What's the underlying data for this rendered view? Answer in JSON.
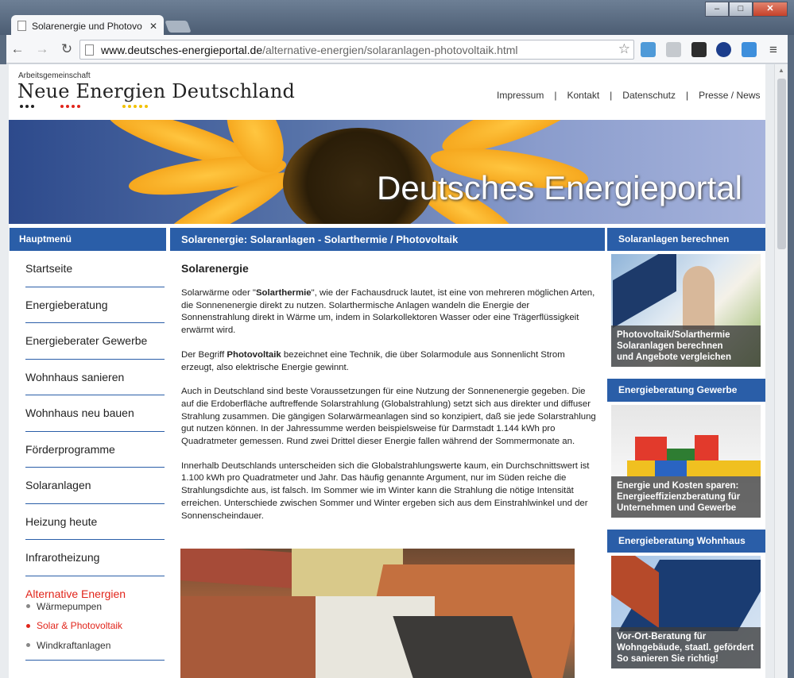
{
  "browser": {
    "tab_title": "Solarenergie und Photovo",
    "url_domain": "www.deutsches-energieportal.de",
    "url_path": "/alternative-energien/solaranlagen-photovoltaik.html",
    "window_min": "–",
    "window_max": "□",
    "window_close": "✕"
  },
  "site": {
    "org_line": "Arbeitsgemeinschaft",
    "logo": "Neue Energien Deutschland",
    "nav": [
      "Impressum",
      "Kontakt",
      "Datenschutz",
      "Presse / News"
    ],
    "banner_title": "Deutsches Energieportal"
  },
  "sidebar": {
    "header": "Hauptmenü",
    "items": [
      "Startseite",
      "Energieberatung",
      "Energieberater Gewerbe",
      "Wohnhaus sanieren",
      "Wohnhaus neu bauen",
      "Förderprogramme",
      "Solaranlagen",
      "Heizung heute",
      "Infrarotheizung"
    ],
    "active_section": "Alternative Energien",
    "subitems": [
      "Wärmepumpen",
      "Solar & Photovoltaik",
      "Windkraftanlagen"
    ]
  },
  "content": {
    "header": "Solarenergie: Solaranlagen - Solarthermie / Photovoltaik",
    "title": "Solarenergie",
    "p1_a": "Solarwärme oder \"",
    "p1_b": "Solarthermie",
    "p1_c": "\", wie der Fachausdruck lautet, ist eine von mehreren möglichen Arten, die Sonnenenergie direkt zu nutzen. Solarthermische Anlagen wandeln die Energie der Sonnenstrahlung direkt in Wärme um, indem in Solarkollektoren Wasser oder eine Trägerflüssigkeit erwärmt wird.",
    "p2_a": "Der Begriff ",
    "p2_b": "Photovoltaik",
    "p2_c": " bezeichnet eine Technik, die über Solarmodule aus Sonnenlicht Strom erzeugt, also elektrische Energie gewinnt.",
    "p3": "Auch in Deutschland sind beste Voraussetzungen für eine Nutzung der Sonnenenergie gegeben. Die auf die Erdoberfläche auftreffende Solarstrahlung (Globalstrahlung) setzt sich aus direkter und diffuser Strahlung zusammen. Die gängigen Solarwärmeanlagen sind so konzipiert, daß sie jede Solarstrahlung gut nutzen können. In der Jahressumme werden beispielsweise für Darmstadt 1.144 kWh pro Quadratmeter gemessen. Rund zwei Drittel dieser Energie fallen während der Sommermonate an.",
    "p4": "Innerhalb Deutschlands unterscheiden sich die Globalstrahlungswerte kaum, ein Durchschnittswert ist 1.100 kWh pro Quadratmeter und Jahr. Das häufig genannte Argument, nur im Süden reiche die Strahlungsdichte aus, ist falsch. Im Sommer wie im Winter kann die Strahlung die nötige Intensität erreichen. Unterschiede zwischen Sommer und Winter ergeben sich aus dem Einstrahlwinkel und der Sonnenscheindauer."
  },
  "right": [
    {
      "header": "Solaranlagen berechnen",
      "caption": [
        "Photovoltaik/Solarthermie",
        "Solaranlagen berechnen",
        "und Angebote vergleichen"
      ]
    },
    {
      "header": "Energieberatung Gewerbe",
      "caption": [
        "Energie und Kosten sparen:",
        "Energieeffizienzberatung für",
        "Unternehmen und Gewerbe"
      ]
    },
    {
      "header": "Energieberatung Wohnhaus",
      "caption": [
        "Vor-Ort-Beratung für",
        "Wohngebäude, staatl. gefördert",
        "So sanieren Sie richtig!"
      ]
    }
  ]
}
